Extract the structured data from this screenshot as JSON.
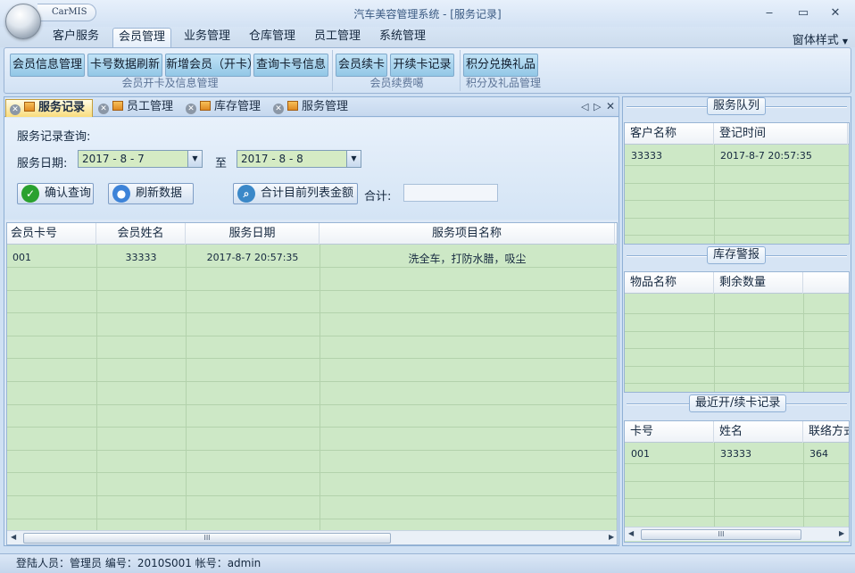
{
  "window": {
    "app_label": "CarMIS",
    "title": "汽车美容管理系统 - [服务记录]"
  },
  "ribbon_tabs": [
    "客户服务",
    "会员管理",
    "业务管理",
    "仓库管理",
    "员工管理",
    "系统管理"
  ],
  "ribbon_active_tab": "会员管理",
  "style_menu": "窗体样式",
  "ribbon_groups": [
    {
      "label": "会员开卡及信息管理",
      "buttons": [
        "会员信息管理",
        "卡号数据刷新",
        "新增会员（开卡）",
        "查询卡号信息"
      ]
    },
    {
      "label": "会员续费噶",
      "buttons": [
        "会员续卡",
        "开续卡记录"
      ]
    },
    {
      "label": "积分及礼品管理",
      "buttons": [
        "积分兑换礼品"
      ]
    }
  ],
  "doc_tabs": [
    "服务记录",
    "员工管理",
    "库存管理",
    "服务管理"
  ],
  "doc_active_tab": "服务记录",
  "query": {
    "section_label": "服务记录查询:",
    "date_label": "服务日期:",
    "date_from": "2017 - 8 - 7",
    "to_label": "至",
    "date_to": "2017 - 8 - 8",
    "confirm_button": "确认查询",
    "refresh_button": "刷新数据",
    "sum_button": "合计目前列表金额",
    "total_label": "合计:",
    "total_value": ""
  },
  "service_grid": {
    "columns": [
      "会员卡号",
      "会员姓名",
      "服务日期",
      "服务项目名称"
    ],
    "rows": [
      [
        "001",
        "33333",
        "2017-8-7 20:57:35",
        "洗全车，打防水腊，吸尘"
      ]
    ]
  },
  "queue": {
    "title": "服务队列",
    "columns": [
      "客户名称",
      "登记时间"
    ],
    "rows": [
      [
        "33333",
        "2017-8-7 20:57:35"
      ]
    ]
  },
  "stock_alert": {
    "title": "库存警报",
    "columns": [
      "物品名称",
      "剩余数量"
    ],
    "rows": []
  },
  "recent_cards": {
    "title": "最近开/续卡记录",
    "columns": [
      "卡号",
      "姓名",
      "联络方式"
    ],
    "rows": [
      [
        "001",
        "33333",
        "364"
      ]
    ]
  },
  "statusbar": {
    "text": "登陆人员：管理员  编号：2010S001  帐号：admin"
  },
  "colors": {
    "grid_background": "#cde8c6",
    "active_tab": "#f9dc7c",
    "ribbon_button": "#92c7e6"
  }
}
